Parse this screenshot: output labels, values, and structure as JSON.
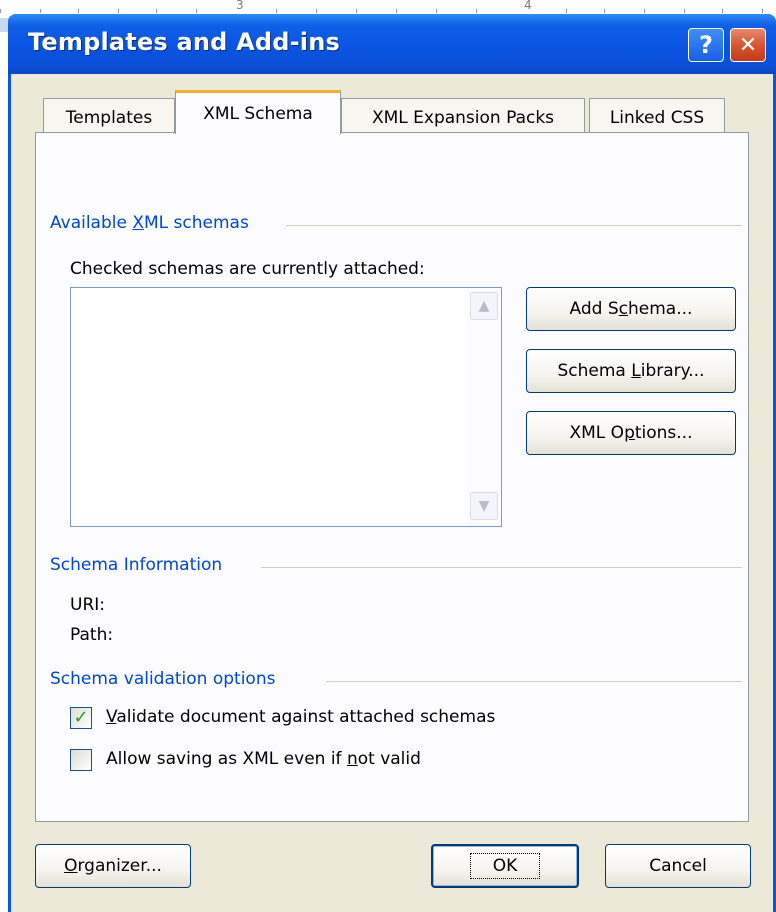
{
  "window": {
    "title": "Templates and Add-ins",
    "help_glyph": "?",
    "close_glyph": "✕"
  },
  "ruler": {
    "marks": [
      "3",
      "4"
    ]
  },
  "tabs": [
    {
      "label": "Templates",
      "active": false
    },
    {
      "label": "XML Schema",
      "active": true
    },
    {
      "label": "XML Expansion Packs",
      "active": false
    },
    {
      "label": "Linked CSS",
      "active": false
    }
  ],
  "available_group": {
    "label_pre": "Available ",
    "label_u": "X",
    "label_post": "ML schemas",
    "hint": "Checked schemas are currently attached:"
  },
  "buttons": {
    "add_schema": {
      "pre": "Add S",
      "u": "c",
      "post": "hema..."
    },
    "schema_library": {
      "pre": "Schema ",
      "u": "L",
      "post": "ibrary..."
    },
    "xml_options": {
      "pre": "XML O",
      "u": "p",
      "post": "tions..."
    },
    "organizer": {
      "pre": "",
      "u": "O",
      "post": "rganizer..."
    },
    "ok": "OK",
    "cancel": "Cancel"
  },
  "schema_info": {
    "label": "Schema Information",
    "uri_label": "URI:",
    "path_label": "Path:"
  },
  "validation": {
    "label": "Schema validation options",
    "validate": {
      "u": "V",
      "post": "alidate document against attached schemas",
      "checked": true
    },
    "allow_saving": {
      "pre": "Allow saving as XML even if ",
      "u": "n",
      "post": "ot valid",
      "checked": false
    }
  },
  "colors": {
    "title_bar": "#0a55e3",
    "group_label": "#0046d5",
    "dialog_bg": "#ece9d8",
    "checkmark": "#21a121"
  },
  "icons": {
    "scroll_up": "▲",
    "scroll_down": "▼",
    "check": "✓"
  }
}
